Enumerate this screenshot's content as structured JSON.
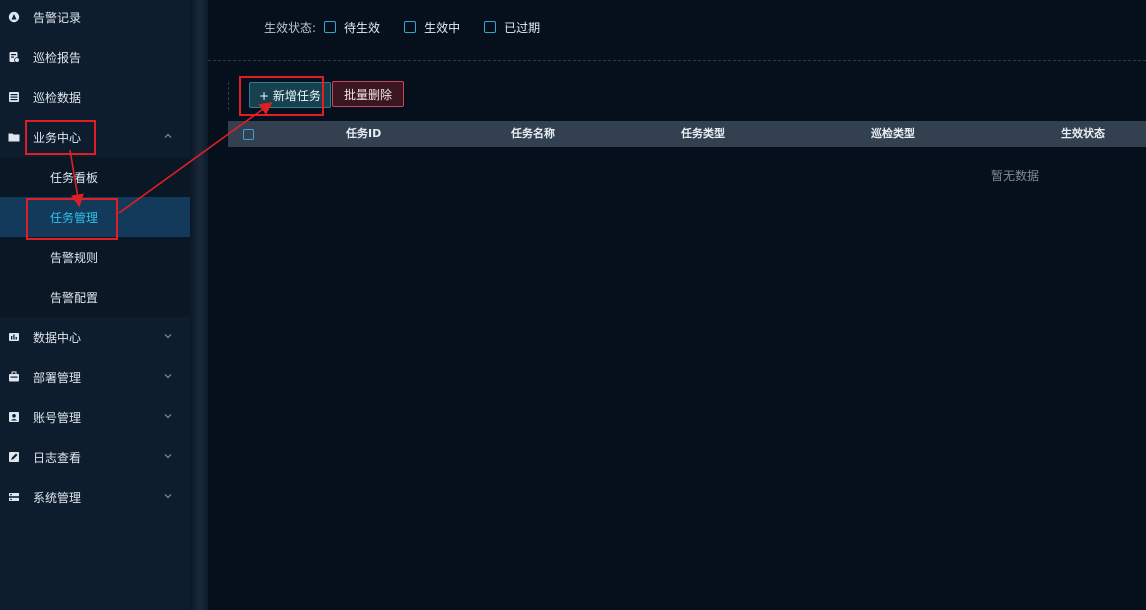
{
  "sidebar": {
    "items_top": [
      {
        "label": "告警记录",
        "icon": "alarm-icon"
      },
      {
        "label": "巡检报告",
        "icon": "report-icon"
      },
      {
        "label": "巡检数据",
        "icon": "data-icon"
      }
    ],
    "business_center": {
      "label": "业务中心",
      "icon": "folder-icon",
      "expanded": true,
      "children": [
        {
          "label": "任务看板"
        },
        {
          "label": "任务管理",
          "active": true
        },
        {
          "label": "告警规则"
        },
        {
          "label": "告警配置"
        }
      ]
    },
    "items_bottom": [
      {
        "label": "数据中心",
        "icon": "chart-icon"
      },
      {
        "label": "部署管理",
        "icon": "deploy-icon"
      },
      {
        "label": "账号管理",
        "icon": "account-icon"
      },
      {
        "label": "日志查看",
        "icon": "log-icon"
      },
      {
        "label": "系统管理",
        "icon": "system-icon"
      }
    ]
  },
  "filter": {
    "label": "生效状态:",
    "options": [
      {
        "label": "待生效",
        "checked": false
      },
      {
        "label": "生效中",
        "checked": false
      },
      {
        "label": "已过期",
        "checked": false
      }
    ]
  },
  "toolbar": {
    "add_label": "+ 新增任务",
    "batch_delete_label": "批量删除"
  },
  "table": {
    "columns": [
      "任务ID",
      "任务名称",
      "任务类型",
      "巡检类型",
      "生效状态"
    ],
    "empty_text": "暂无数据",
    "rows": []
  },
  "colors": {
    "active_text": "#2ec2ea",
    "highlight": "#e01f24",
    "add_button_bg": "#17414f",
    "delete_button_border": "#c2485a"
  }
}
